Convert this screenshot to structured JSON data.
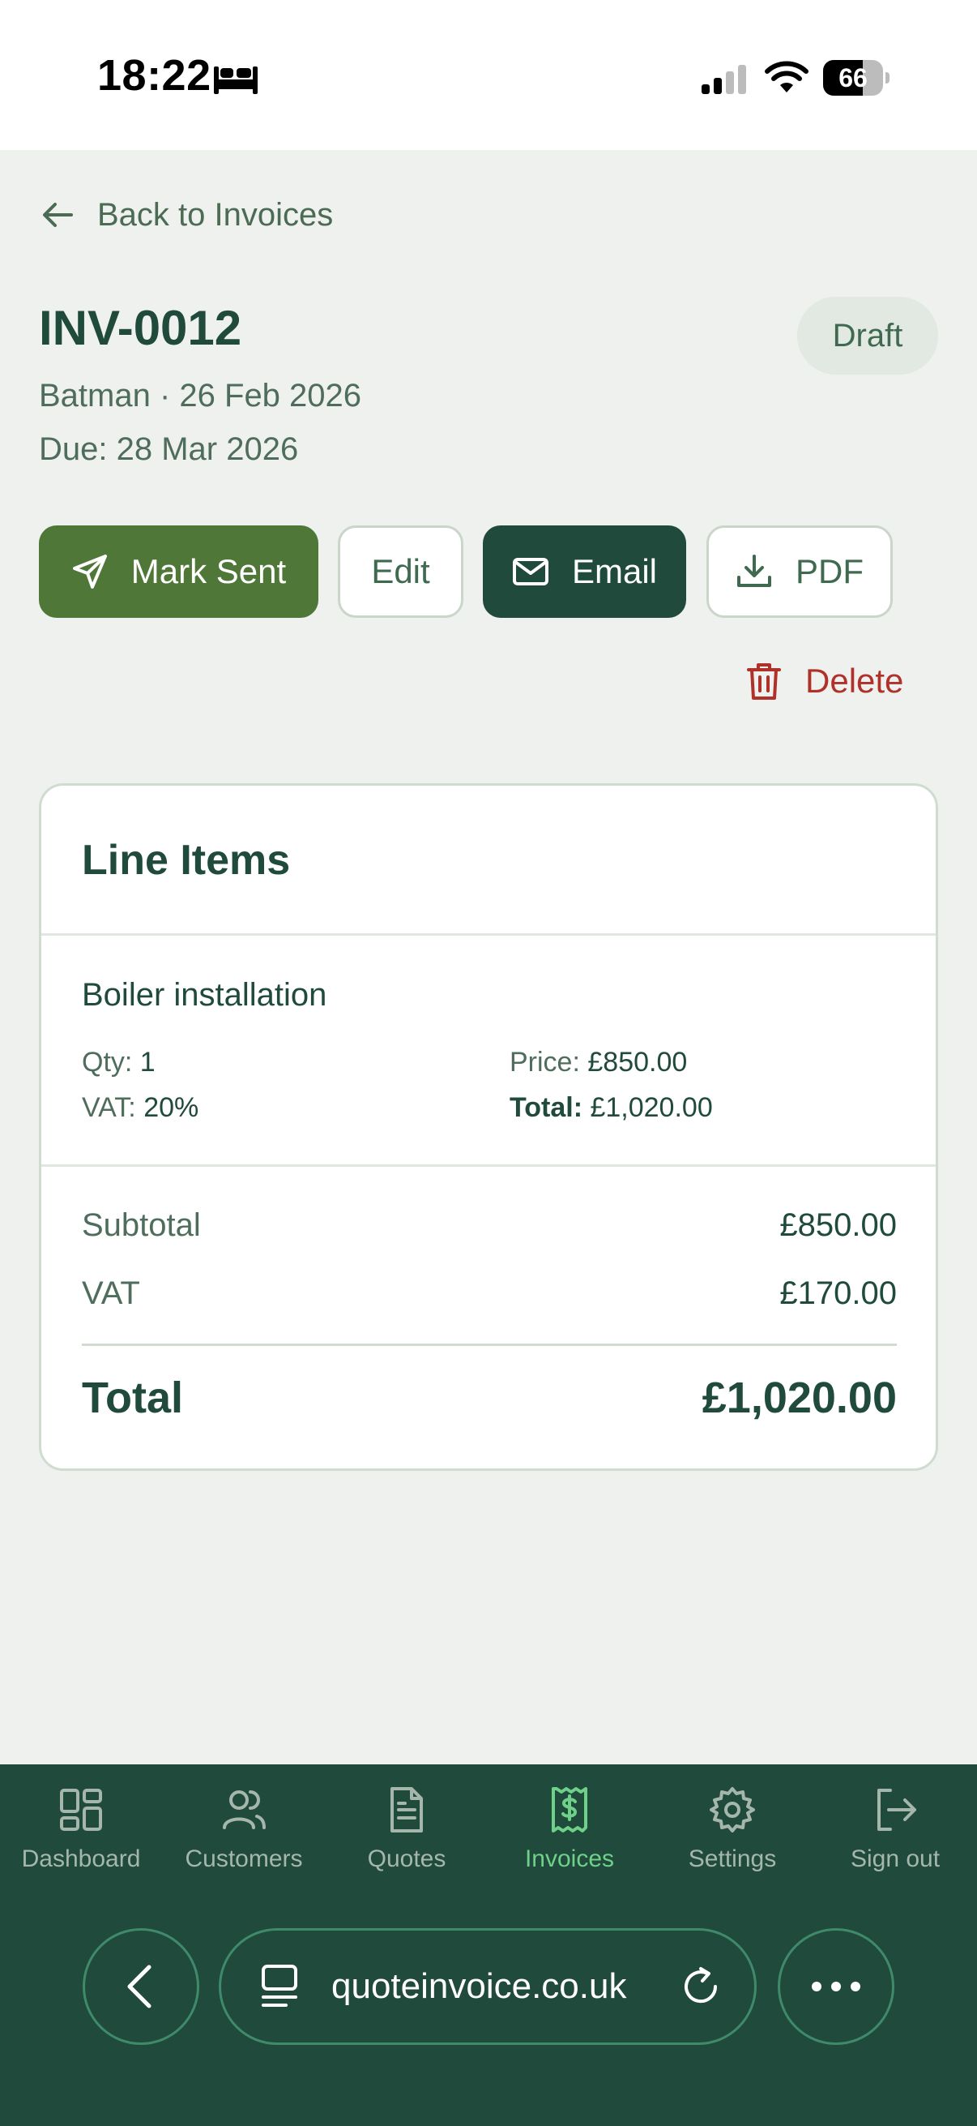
{
  "status_bar": {
    "time": "18:22",
    "battery_level": 66,
    "battery_label": "66",
    "icons": [
      "bed-icon",
      "signal-icon",
      "wifi-icon",
      "battery-icon"
    ]
  },
  "back_link": {
    "label": "Back to Invoices",
    "icon": "arrow-left-icon"
  },
  "invoice": {
    "number": "INV-0012",
    "customer_date": "Batman · 26 Feb 2026",
    "due": "Due: 28 Mar 2026",
    "status": "Draft"
  },
  "actions": {
    "mark_sent": "Mark Sent",
    "edit": "Edit",
    "email": "Email",
    "pdf": "PDF",
    "delete": "Delete"
  },
  "line_items": {
    "title": "Line Items",
    "items": [
      {
        "name": "Boiler installation",
        "qty_label": "Qty:",
        "qty": "1",
        "vat_label": "VAT:",
        "vat": "20%",
        "price_label": "Price:",
        "price": "£850.00",
        "total_label": "Total:",
        "total": "£1,020.00"
      }
    ],
    "summary": {
      "subtotal_label": "Subtotal",
      "subtotal": "£850.00",
      "vat_label": "VAT",
      "vat": "£170.00",
      "total_label": "Total",
      "total": "£1,020.00"
    }
  },
  "nav": {
    "items": [
      {
        "label": "Dashboard",
        "icon": "dashboard-icon"
      },
      {
        "label": "Customers",
        "icon": "users-icon"
      },
      {
        "label": "Quotes",
        "icon": "document-icon"
      },
      {
        "label": "Invoices",
        "icon": "receipt-icon",
        "active": true
      },
      {
        "label": "Settings",
        "icon": "gear-icon"
      },
      {
        "label": "Sign out",
        "icon": "sign-out-icon"
      }
    ]
  },
  "browser": {
    "url": "quoteinvoice.co.uk"
  },
  "colors": {
    "primary_dark": "#1f4a3c",
    "primary_green": "#4f7838",
    "active_nav": "#6fd08a",
    "danger": "#b0302a",
    "background": "#eff1ee"
  }
}
